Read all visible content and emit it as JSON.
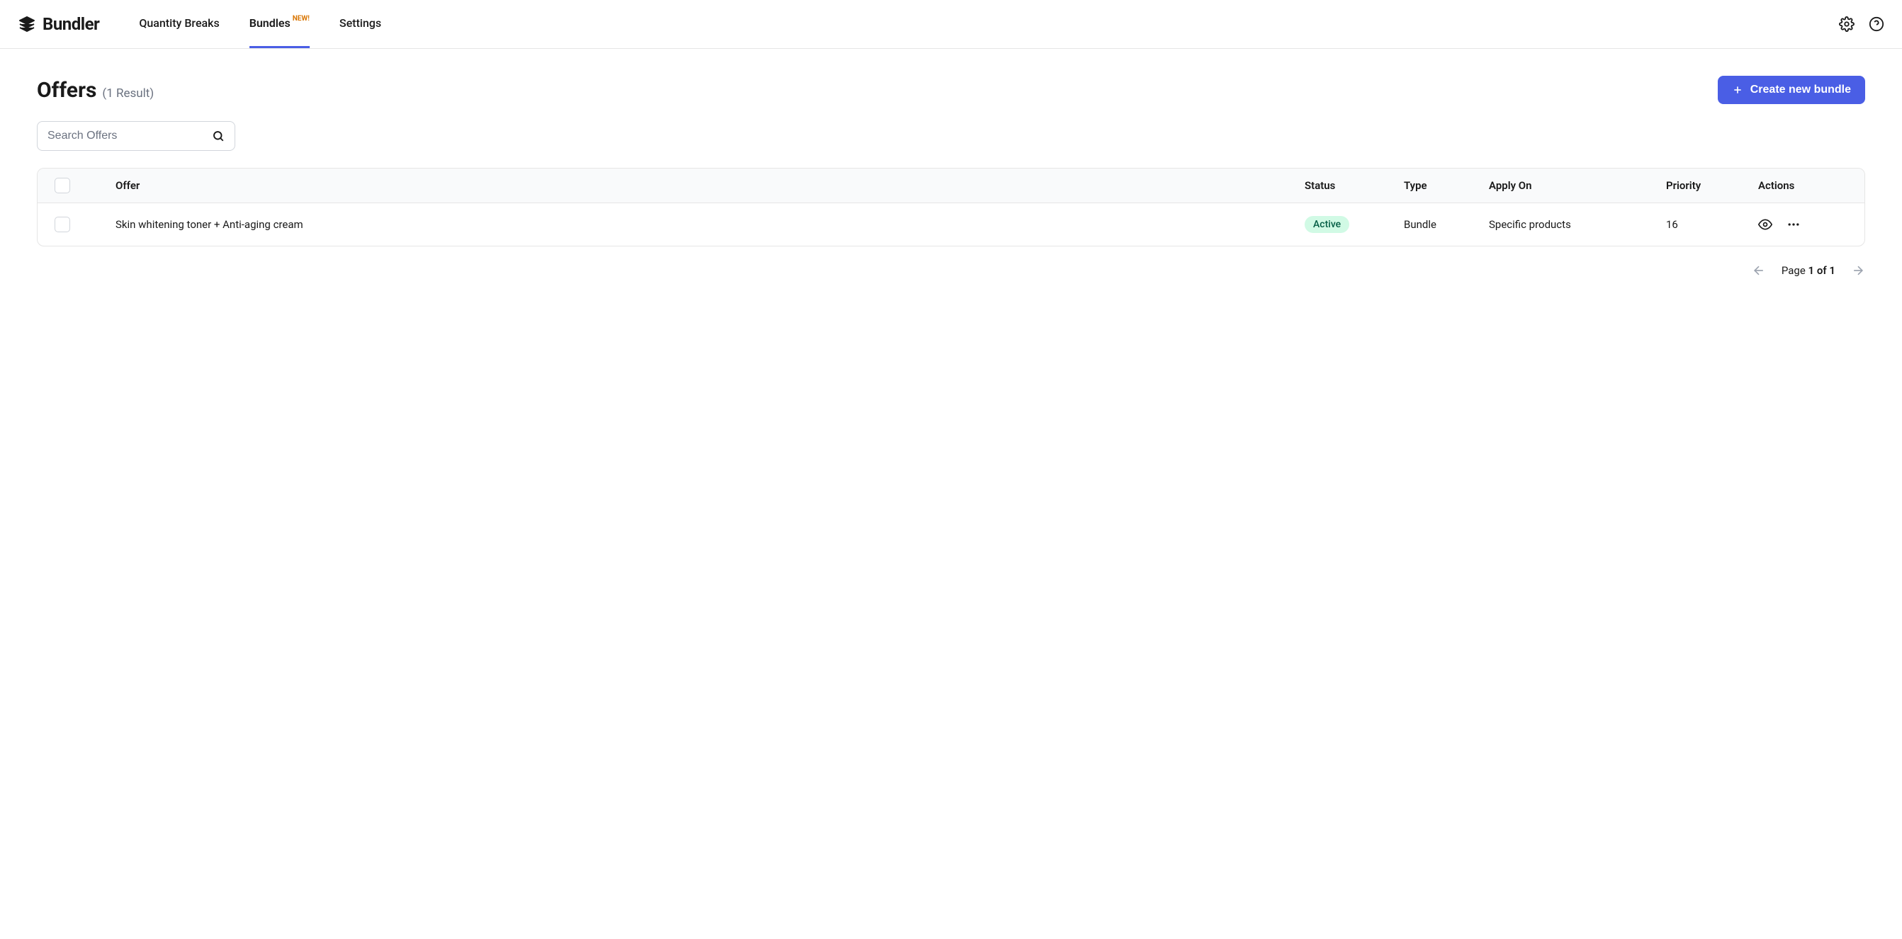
{
  "brand": {
    "name": "Bundler"
  },
  "nav": {
    "items": [
      {
        "label": "Quantity Breaks",
        "active": false,
        "badge": null
      },
      {
        "label": "Bundles",
        "active": true,
        "badge": "NEW!"
      },
      {
        "label": "Settings",
        "active": false,
        "badge": null
      }
    ]
  },
  "header": {
    "title": "Offers",
    "result_text": "(1 Result)",
    "create_button": "Create new bundle"
  },
  "search": {
    "placeholder": "Search Offers",
    "value": ""
  },
  "table": {
    "columns": {
      "offer": "Offer",
      "status": "Status",
      "type": "Type",
      "apply_on": "Apply On",
      "priority": "Priority",
      "actions": "Actions"
    },
    "rows": [
      {
        "offer": "Skin whitening toner + Anti-aging cream",
        "status": "Active",
        "type": "Bundle",
        "apply_on": "Specific products",
        "priority": "16"
      }
    ]
  },
  "pagination": {
    "label_prefix": "Page",
    "current": "1",
    "of": "of",
    "total": "1"
  }
}
